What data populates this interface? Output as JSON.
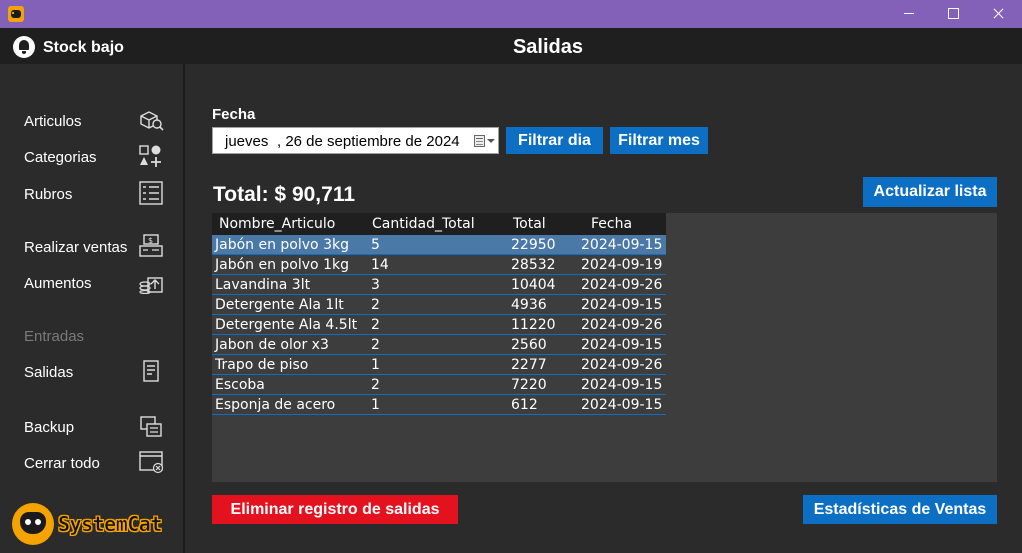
{
  "window": {
    "title": ""
  },
  "header": {
    "stock_label": "Stock bajo",
    "page_title": "Salidas"
  },
  "sidebar": {
    "items": [
      {
        "label": "Articulos",
        "icon": "articles-icon"
      },
      {
        "label": "Categorias",
        "icon": "categories-icon"
      },
      {
        "label": "Rubros",
        "icon": "rubros-icon"
      },
      {
        "label": "Realizar ventas",
        "icon": "cash-register-icon"
      },
      {
        "label": "Aumentos",
        "icon": "price-increase-icon"
      },
      {
        "label": "Entradas",
        "icon": "",
        "disabled": true
      },
      {
        "label": "Salidas",
        "icon": "receipt-icon"
      },
      {
        "label": "Backup",
        "icon": "backup-icon"
      },
      {
        "label": "Cerrar todo",
        "icon": "close-window-icon"
      }
    ],
    "logo_text": "SystemCat"
  },
  "filter": {
    "fecha_label": "Fecha",
    "date_day": "jueves",
    "date_rest": ", 26 de septiembre de 2024",
    "btn_dia": "Filtrar dia",
    "btn_mes": "Filtrar mes"
  },
  "total_label": "Total: $ 90,711",
  "btn_actualizar": "Actualizar lista",
  "table": {
    "headers": [
      "Nombre_Articulo",
      "Cantidad_Total",
      "Total",
      "Fecha"
    ],
    "rows": [
      [
        "Jabón en polvo 3kg",
        "5",
        "22950",
        "2024-09-15"
      ],
      [
        "Jabón en polvo 1kg",
        "14",
        "28532",
        "2024-09-19"
      ],
      [
        "Lavandina 3lt",
        "3",
        "10404",
        "2024-09-26"
      ],
      [
        "Detergente Ala 1lt",
        "2",
        "4936",
        "2024-09-15"
      ],
      [
        "Detergente Ala 4.5lt",
        "2",
        "11220",
        "2024-09-26"
      ],
      [
        "Jabon de olor x3",
        "2",
        "2560",
        "2024-09-15"
      ],
      [
        "Trapo de piso",
        "1",
        "2277",
        "2024-09-26"
      ],
      [
        "Escoba",
        "2",
        "7220",
        "2024-09-15"
      ],
      [
        "Esponja de acero",
        "1",
        "612",
        "2024-09-15"
      ]
    ],
    "selected_row": 0
  },
  "btn_eliminar": "Eliminar registro de salidas",
  "btn_estadisticas": "Estadísticas de Ventas",
  "colors": {
    "titlebar": "#8461b8",
    "accent": "#0c6fc4",
    "danger": "#e4111f",
    "selected": "#4a79a8"
  }
}
